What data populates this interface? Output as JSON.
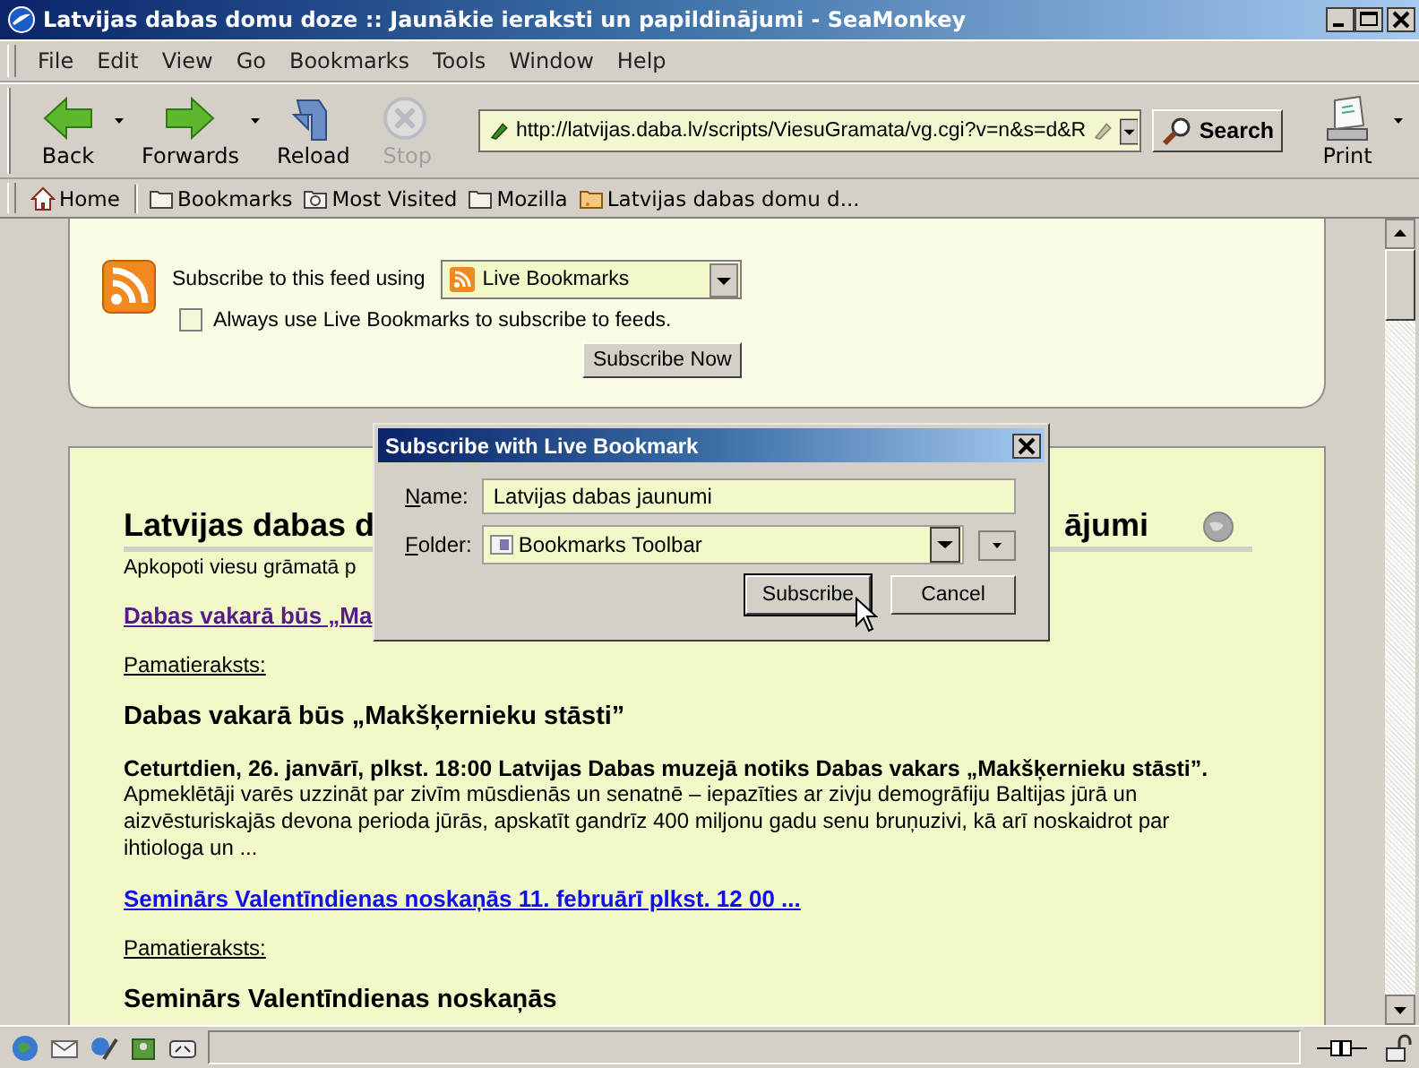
{
  "window": {
    "title": "Latvijas dabas domu doze :: Jaunākie ieraksti un papildinājumi - SeaMonkey"
  },
  "menu": [
    "File",
    "Edit",
    "View",
    "Go",
    "Bookmarks",
    "Tools",
    "Window",
    "Help"
  ],
  "nav_buttons": [
    {
      "label": "Back",
      "kind": "back",
      "disabled": false,
      "dropdown": true
    },
    {
      "label": "Forwards",
      "kind": "forward",
      "disabled": false,
      "dropdown": true
    },
    {
      "label": "Reload",
      "kind": "reload",
      "disabled": false,
      "dropdown": false
    },
    {
      "label": "Stop",
      "kind": "stop",
      "disabled": true,
      "dropdown": false
    }
  ],
  "address": {
    "value": "http://latvijas.daba.lv/scripts/ViesuGramata/vg.cgi?v=n&s=d&R"
  },
  "search_button": "Search",
  "print_button": "Print",
  "bookmarks_bar": [
    {
      "label": "Home",
      "kind": "home"
    },
    {
      "label": "Bookmarks",
      "kind": "folder"
    },
    {
      "label": "Most Visited",
      "kind": "smart"
    },
    {
      "label": "Mozilla",
      "kind": "folder"
    },
    {
      "label": "Latvijas dabas domu d...",
      "kind": "feed"
    }
  ],
  "feed_box": {
    "subscribe_label": "Subscribe to this feed using",
    "reader": "Live Bookmarks",
    "always_use": {
      "label": "Always use Live Bookmarks to subscribe to feeds.",
      "checked": false
    },
    "button": "Subscribe Now"
  },
  "article": {
    "heading_start": "Latvijas dabas d",
    "heading_end": "ājumi",
    "intro": "Apkopoti viesu grāmatā p",
    "entries": [
      {
        "link": "Dabas vakarā būs „Ma",
        "visited": true,
        "source_label": "Pamatieraksts:",
        "title": "Dabas vakarā būs „Makšķernieku stāsti”",
        "lead": "Ceturtdien, 26. janvārī, plkst. 18:00 Latvijas Dabas muzejā notiks Dabas vakars „Makšķernieku stāsti”.",
        "body": "Apmeklētāji varēs uzzināt par zivīm mūsdienās un senatnē – iepazīties ar zivju demogrāfiju Baltijas jūrā un aizvēsturiskajās devona perioda jūrās, apskatīt gandrīz 400 miljonu gadu senu bruņuzivi, kā arī noskaidrot par ihtiologa un ..."
      },
      {
        "link": "Seminārs Valentīndienas noskaņās 11. februārī plkst. 12 00 ...",
        "visited": false,
        "source_label": "Pamatieraksts:",
        "title": "Seminārs Valentīndienas noskaņās"
      }
    ]
  },
  "dialog": {
    "title": "Subscribe with Live Bookmark",
    "name_label": "Name:",
    "name_value": "Latvijas dabas jaunumi",
    "folder_label": "Folder:",
    "folder_value": "Bookmarks Toolbar",
    "buttons": [
      {
        "label": "Subscribe",
        "default": true
      },
      {
        "label": "Cancel",
        "default": false
      }
    ]
  }
}
